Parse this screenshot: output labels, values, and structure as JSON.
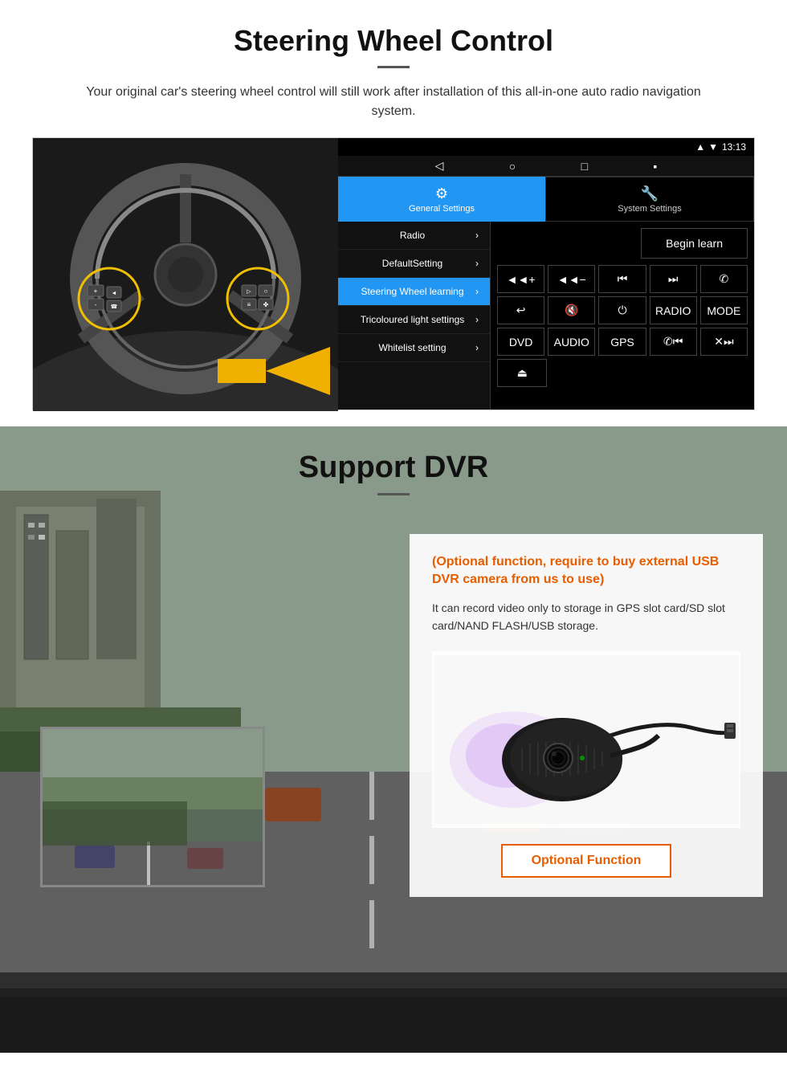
{
  "page": {
    "section1": {
      "title": "Steering Wheel Control",
      "subtitle": "Your original car's steering wheel control will still work after installation of this all-in-one auto radio navigation system.",
      "status_bar": {
        "time": "13:13",
        "icons": [
          "wifi",
          "signal",
          "battery"
        ]
      },
      "nav_icons": [
        "◁",
        "○",
        "□",
        "▪"
      ],
      "tabs": [
        {
          "icon": "⚙",
          "label": "General Settings",
          "active": true
        },
        {
          "icon": "🔧",
          "label": "System Settings",
          "active": false
        }
      ],
      "menu_items": [
        {
          "label": "Radio",
          "active": false
        },
        {
          "label": "DefaultSetting",
          "active": false
        },
        {
          "label": "Steering Wheel learning",
          "active": true
        },
        {
          "label": "Tricoloured light settings",
          "active": false
        },
        {
          "label": "Whitelist setting",
          "active": false
        }
      ],
      "begin_learn_label": "Begin learn",
      "control_buttons_row1": [
        {
          "icon": "◄◄+",
          "label": "vol_up"
        },
        {
          "icon": "◄◄-",
          "label": "vol_down"
        },
        {
          "icon": "◄◄",
          "label": "prev"
        },
        {
          "icon": "▶▶",
          "label": "next"
        },
        {
          "icon": "✆",
          "label": "call"
        }
      ],
      "control_buttons_row2": [
        {
          "icon": "↩",
          "label": "back"
        },
        {
          "icon": "◄◄×",
          "label": "mute"
        },
        {
          "icon": "⏻",
          "label": "power"
        },
        {
          "icon": "RADIO",
          "label": "radio"
        },
        {
          "icon": "MODE",
          "label": "mode"
        }
      ],
      "control_buttons_row3": [
        {
          "icon": "DVD",
          "label": "dvd"
        },
        {
          "icon": "AUDIO",
          "label": "audio"
        },
        {
          "icon": "GPS",
          "label": "gps"
        },
        {
          "icon": "✆◄◄",
          "label": "tel_prev"
        },
        {
          "icon": "✕▶▶",
          "label": "tel_next"
        }
      ],
      "control_buttons_row4": [
        {
          "icon": "⏏",
          "label": "eject"
        }
      ]
    },
    "section2": {
      "title": "Support DVR",
      "optional_text": "(Optional function, require to buy external USB DVR camera from us to use)",
      "description": "It can record video only to storage in GPS slot card/SD slot card/NAND FLASH/USB storage.",
      "optional_function_label": "Optional Function"
    }
  }
}
